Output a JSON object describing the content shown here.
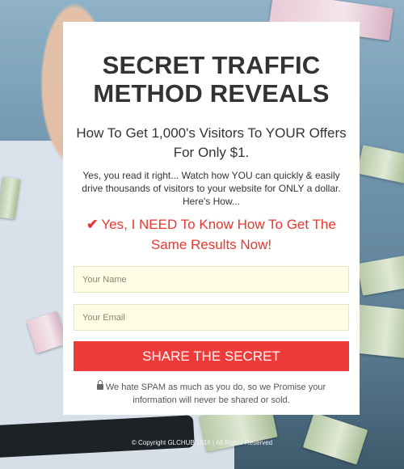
{
  "card": {
    "title_line1": "SECRET TRAFFIC",
    "title_line2": "METHOD REVEALS",
    "subtitle": "How To Get 1,000's Visitors To YOUR Offers For Only $1.",
    "description": "Yes, you read it right... Watch how YOU can quickly & easily drive thousands of visitors to your website for ONLY a dollar. Here's How...",
    "cta_check": "✔",
    "cta_text": "Yes, I NEED To Know How To Get The Same Results Now!"
  },
  "form": {
    "name_placeholder": "Your Name",
    "email_placeholder": "Your Email",
    "submit_label": "SHARE THE SECRET",
    "spam_note": "We hate SPAM as much as you do, so we Promise your information will never be shared or sold."
  },
  "footer": {
    "copyright": "© Copyright GLCHUB 2016 | All Rights Reserved"
  },
  "colors": {
    "accent_red": "#ef3a3a",
    "cta_red": "#e8372f",
    "field_bg": "#fefde6"
  }
}
